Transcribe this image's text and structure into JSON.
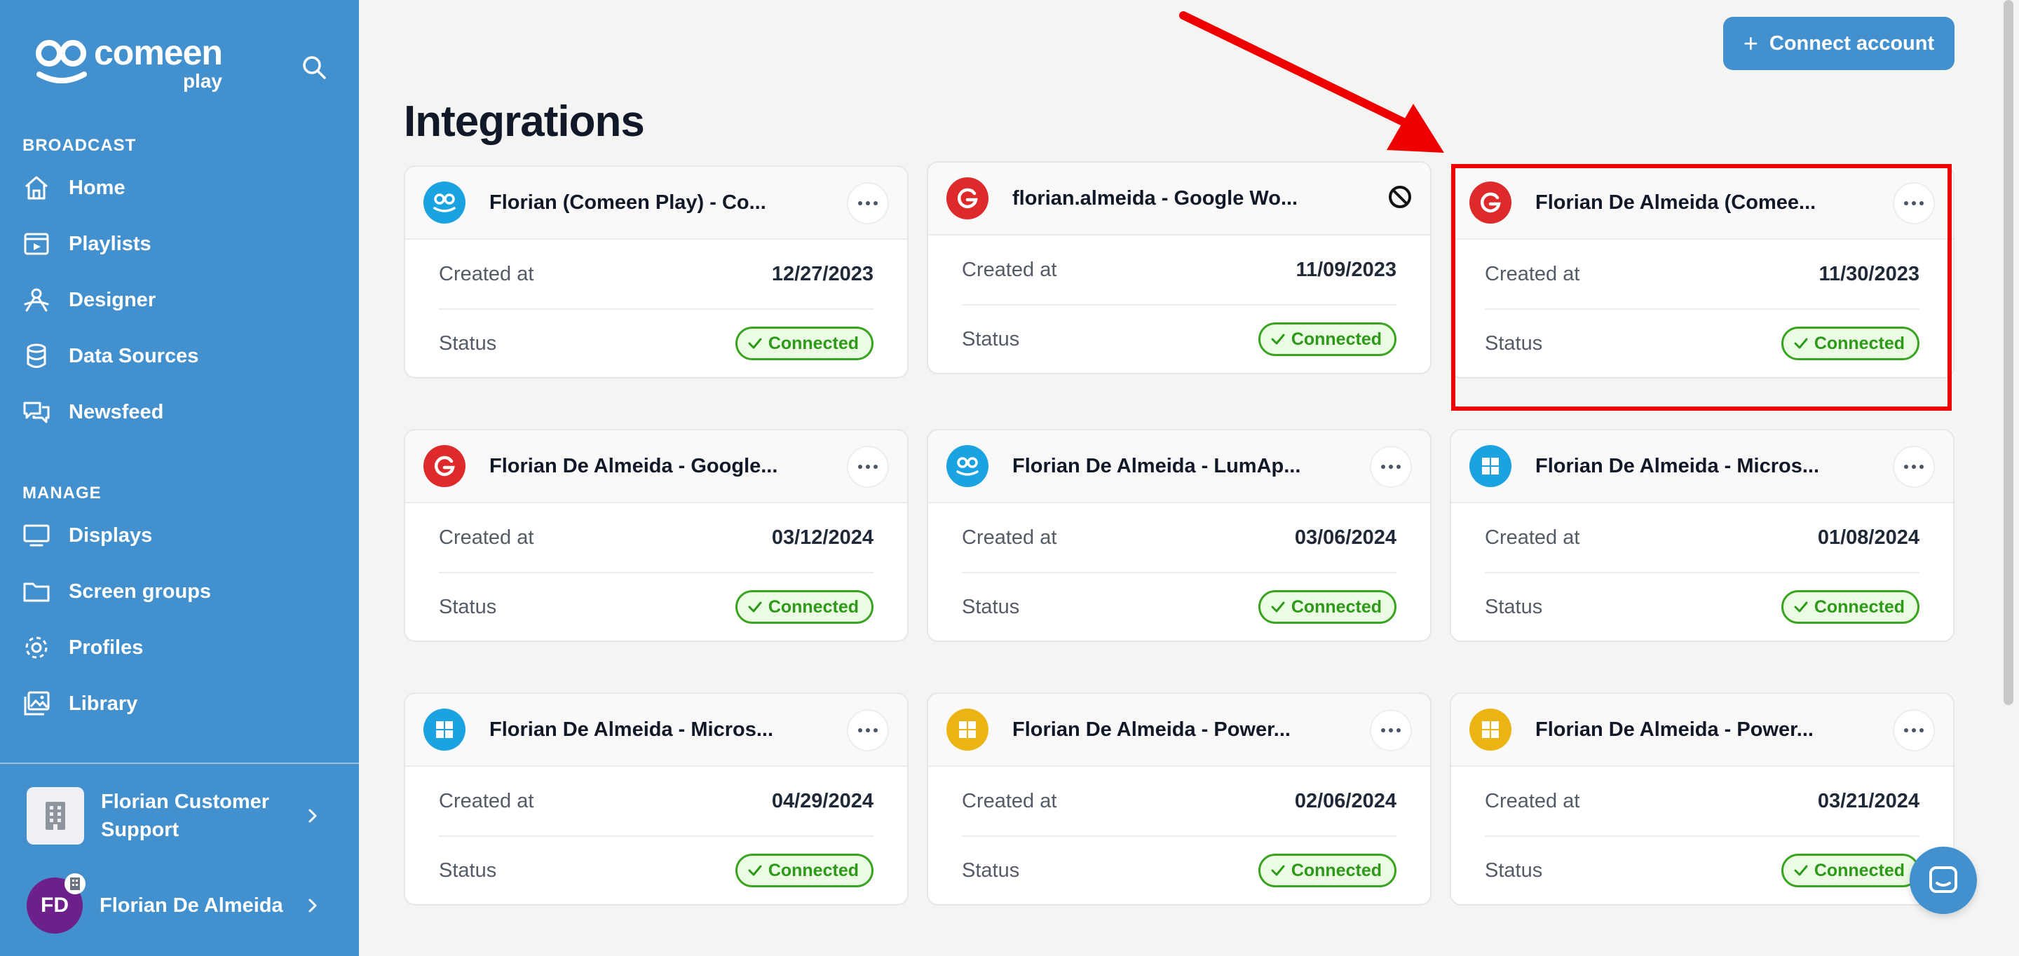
{
  "brand": {
    "name": "comeen",
    "sub": "play"
  },
  "sidebar": {
    "broadcast_title": "BROADCAST",
    "broadcast_items": [
      {
        "label": "Home",
        "icon": "home-icon"
      },
      {
        "label": "Playlists",
        "icon": "playlist-icon"
      },
      {
        "label": "Designer",
        "icon": "designer-icon"
      },
      {
        "label": "Data Sources",
        "icon": "database-icon"
      },
      {
        "label": "Newsfeed",
        "icon": "chat-bubbles-icon"
      }
    ],
    "manage_title": "MANAGE",
    "manage_items": [
      {
        "label": "Displays",
        "icon": "monitor-icon"
      },
      {
        "label": "Screen groups",
        "icon": "folder-icon"
      },
      {
        "label": "Profiles",
        "icon": "gear-icon"
      },
      {
        "label": "Library",
        "icon": "images-icon"
      }
    ],
    "org_name": "Florian Customer Support",
    "user_initials": "FD",
    "user_name": "Florian De Almeida"
  },
  "header": {
    "title": "Integrations",
    "connect_label": "Connect account"
  },
  "labels": {
    "created": "Created at",
    "status": "Status"
  },
  "cards": [
    {
      "title": "Florian (Comeen Play) - Co...",
      "provider": "comeen",
      "date": "12/27/2023",
      "status": "Connected"
    },
    {
      "title": "florian.almeida - Google Wo...",
      "provider": "google",
      "date": "11/09/2023",
      "status": "Connected"
    },
    {
      "title": "Florian De Almeida (Comee...",
      "provider": "google",
      "date": "11/30/2023",
      "status": "Connected"
    },
    {
      "title": "Florian De Almeida - Google...",
      "provider": "google",
      "date": "03/12/2024",
      "status": "Connected"
    },
    {
      "title": "Florian De Almeida - LumAp...",
      "provider": "comeen",
      "date": "03/06/2024",
      "status": "Connected"
    },
    {
      "title": "Florian De Almeida - Micros...",
      "provider": "microsoft",
      "date": "01/08/2024",
      "status": "Connected"
    },
    {
      "title": "Florian De Almeida - Micros...",
      "provider": "microsoft",
      "date": "04/29/2024",
      "status": "Connected"
    },
    {
      "title": "Florian De Almeida - Power...",
      "provider": "powerbi",
      "date": "02/06/2024",
      "status": "Connected"
    },
    {
      "title": "Florian De Almeida - Power...",
      "provider": "powerbi",
      "date": "03/21/2024",
      "status": "Connected"
    }
  ],
  "colors": {
    "sidebar": "#4390cf",
    "accent": "#4390cf",
    "success": "#3aa421",
    "highlight": "#ee0000",
    "google": "#de2a2a",
    "comeen": "#1ba2e0",
    "powerbi": "#ebb412"
  }
}
